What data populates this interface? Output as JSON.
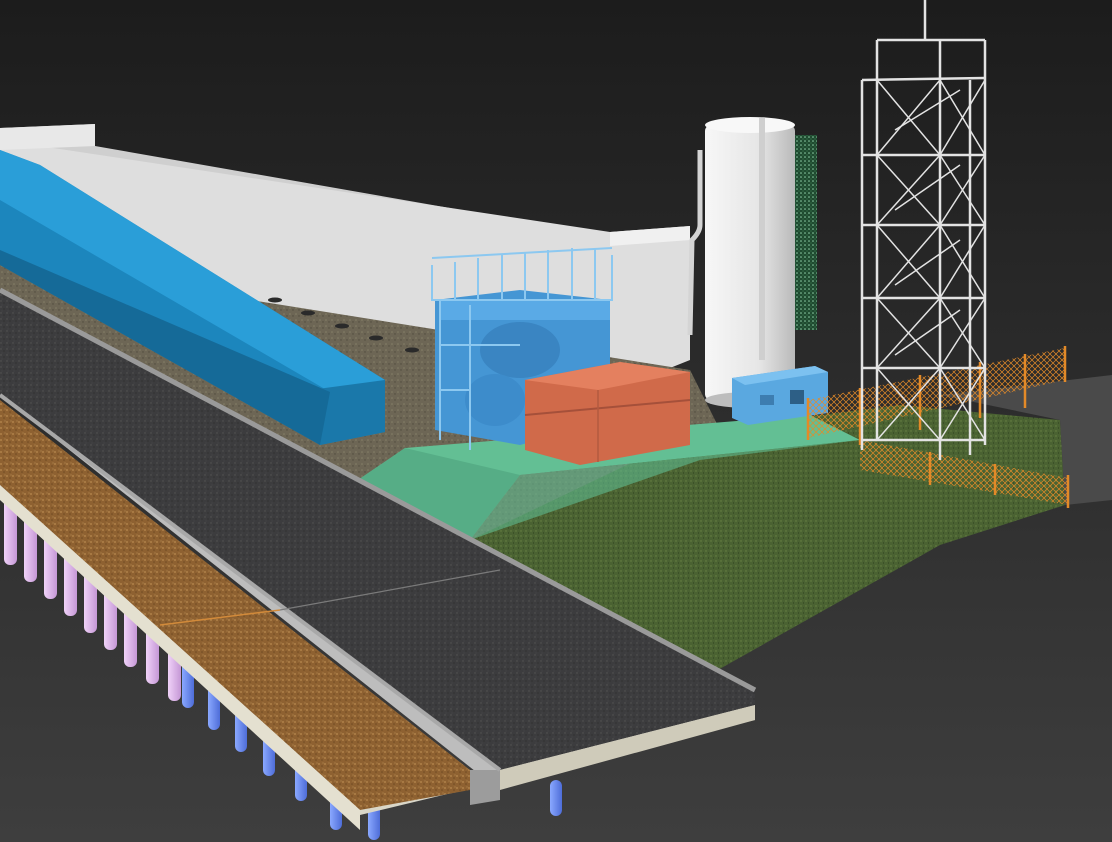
{
  "scene": {
    "background_top": "#1c1c1c",
    "background_bottom": "#3e3e3e",
    "colors": {
      "retaining_wall": "#d9d9d9",
      "channel_blue": "#1f8fc7",
      "treatment_unit_blue": "#4a9fdc",
      "tank_orange": "#d7704f",
      "silo_white": "#ececec",
      "generator_blue": "#66b3e6",
      "platform_green": "#67c39a",
      "grass": "#4a6232",
      "asphalt": "#3e3e40",
      "gravel": "#9a6a38",
      "gutter_concrete": "#b8b8b8",
      "pile_blue": "#6b8cf0",
      "pile_pink": "#e2b6ee",
      "fence_orange": "#e38a28",
      "scaffold": "#e6e6e6",
      "textured_panel": "#2f6b45"
    },
    "objects": [
      {
        "name": "retaining-wall"
      },
      {
        "name": "blue-channel"
      },
      {
        "name": "treatment-unit"
      },
      {
        "name": "orange-tank"
      },
      {
        "name": "storage-silo"
      },
      {
        "name": "textured-panel"
      },
      {
        "name": "generator-unit"
      },
      {
        "name": "scaffold-tower"
      },
      {
        "name": "safety-fence"
      },
      {
        "name": "green-platform"
      },
      {
        "name": "grass-field"
      },
      {
        "name": "gravel-ground"
      },
      {
        "name": "asphalt-road"
      },
      {
        "name": "gravel-median"
      },
      {
        "name": "road-gutter"
      },
      {
        "name": "support-piles"
      }
    ]
  }
}
